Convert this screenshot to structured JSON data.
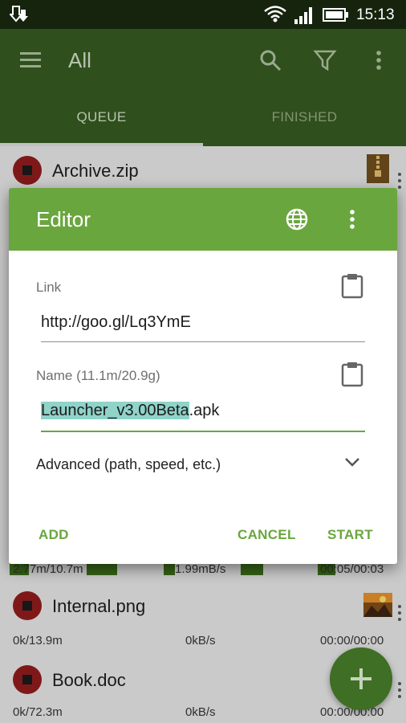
{
  "status_bar": {
    "time": "15:13"
  },
  "appbar": {
    "title": "All"
  },
  "tabs": [
    {
      "label": "QUEUE"
    },
    {
      "label": "FINISHED"
    }
  ],
  "downloads": [
    {
      "name": "Archive.zip"
    },
    {
      "name": "",
      "size": "2.77m/10.7m",
      "speed": "1.99mB/s",
      "time": "00:05/00:03"
    },
    {
      "name": "Internal.png",
      "size": "0k/13.9m",
      "speed": "0kB/s",
      "time": "00:00/00:00"
    },
    {
      "name": "Book.doc",
      "size": "0k/72.3m",
      "speed": "0kB/s",
      "time": "00:00/00:00"
    }
  ],
  "dialog": {
    "title": "Editor",
    "link_label": "Link",
    "link_value": "http://goo.gl/Lq3YmE",
    "name_label": "Name (11.1m/20.9g)",
    "name_selected": "Launcher_v3.00Beta",
    "name_ext": ".apk",
    "advanced_label": "Advanced (path, speed, etc.)",
    "buttons": {
      "add": "ADD",
      "cancel": "CANCEL",
      "start": "START"
    }
  },
  "colors": {
    "primary": "#6aa63e",
    "primary_dark": "#34561f",
    "selection": "#8fd3c9"
  }
}
